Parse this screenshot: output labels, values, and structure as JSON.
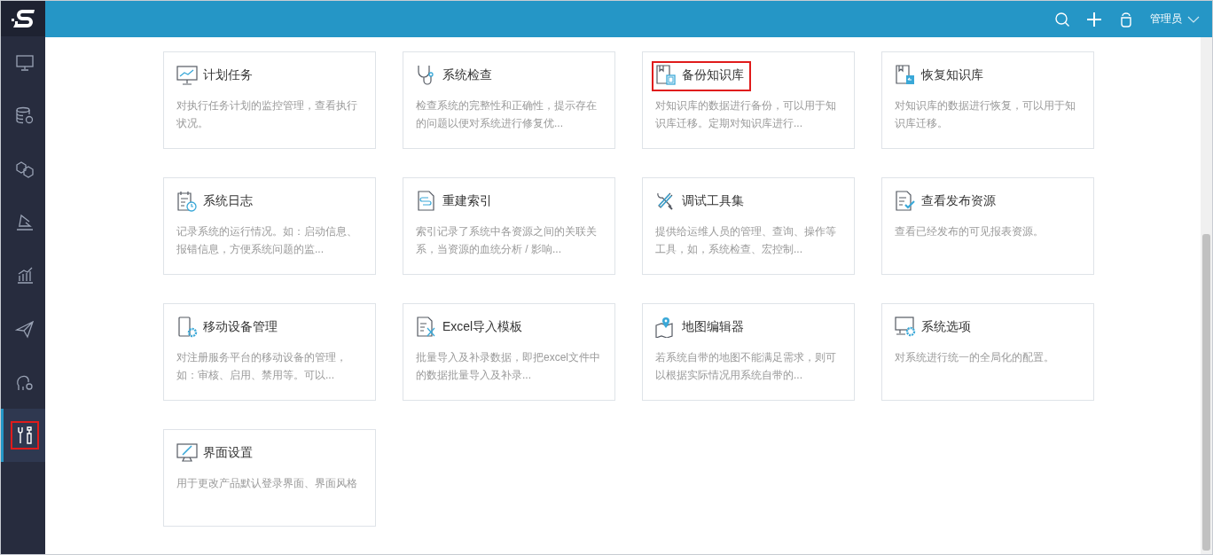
{
  "sidebar": {
    "items": [
      {
        "selected": false,
        "highlighted": false
      },
      {
        "selected": false,
        "highlighted": false
      },
      {
        "selected": false,
        "highlighted": false
      },
      {
        "selected": false,
        "highlighted": false
      },
      {
        "selected": false,
        "highlighted": false
      },
      {
        "selected": false,
        "highlighted": false
      },
      {
        "selected": false,
        "highlighted": false
      },
      {
        "selected": true,
        "highlighted": true
      }
    ]
  },
  "header": {
    "user": "管理员"
  },
  "cards": [
    {
      "title": "计划任务",
      "description": "对执行任务计划的监控管理，查看执行状况。",
      "highlighted": false
    },
    {
      "title": "系统检查",
      "description": "检查系统的完整性和正确性，提示存在的问题以便对系统进行修复优...",
      "highlighted": false
    },
    {
      "title": "备份知识库",
      "description": "对知识库的数据进行备份，可以用于知识库迁移。定期对知识库进行...",
      "highlighted": true
    },
    {
      "title": "恢复知识库",
      "description": "对知识库的数据进行恢复，可以用于知识库迁移。",
      "highlighted": false
    },
    {
      "title": "系统日志",
      "description": "记录系统的运行情况。如：启动信息、报错信息，方便系统问题的监...",
      "highlighted": false
    },
    {
      "title": "重建索引",
      "description": "索引记录了系统中各资源之间的关联关系，当资源的血统分析 / 影响...",
      "highlighted": false
    },
    {
      "title": "调试工具集",
      "description": "提供给运维人员的管理、查询、操作等工具，如，系统检查、宏控制...",
      "highlighted": false
    },
    {
      "title": "查看发布资源",
      "description": "查看已经发布的可见报表资源。",
      "highlighted": false
    },
    {
      "title": "移动设备管理",
      "description": "对注册服务平台的移动设备的管理，如：审核、启用、禁用等。可以...",
      "highlighted": false
    },
    {
      "title": "Excel导入模板",
      "description": "批量导入及补录数据，即把excel文件中的数据批量导入及补录...",
      "highlighted": false
    },
    {
      "title": "地图编辑器",
      "description": "若系统自带的地图不能满足需求，则可以根据实际情况用系统自带的...",
      "highlighted": false
    },
    {
      "title": "系统选项",
      "description": "对系统进行统一的全局化的配置。",
      "highlighted": false
    },
    {
      "title": "界面设置",
      "description": "用于更改产品默认登录界面、界面风格",
      "highlighted": false
    }
  ]
}
